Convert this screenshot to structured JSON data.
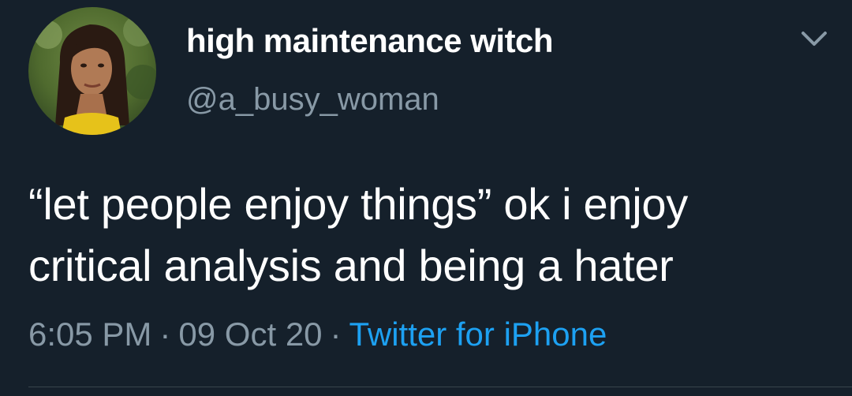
{
  "user": {
    "display_name": "high maintenance witch",
    "handle": "@a_busy_woman"
  },
  "tweet": {
    "line1": "“let people enjoy things” ok i enjoy",
    "line2": "critical analysis and being a hater"
  },
  "meta": {
    "time": "6:05 PM",
    "separator": "·",
    "date": "09 Oct 20",
    "source": "Twitter for iPhone"
  },
  "icons": {
    "menu": "chevron-down-icon"
  },
  "colors": {
    "background": "#15202b",
    "primary_text": "#ffffff",
    "secondary_text": "#8899a6",
    "link": "#1da1f2",
    "divider": "#38444d"
  }
}
